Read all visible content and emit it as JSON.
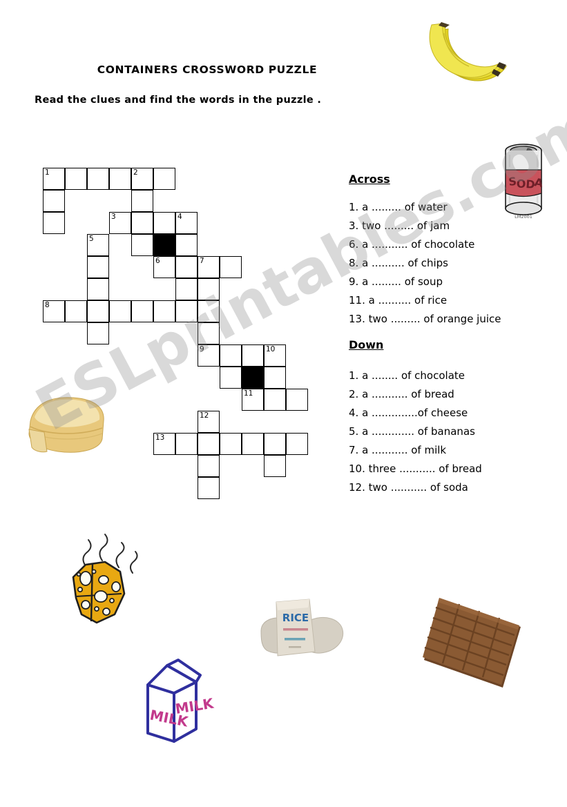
{
  "worksheet": {
    "title": "CONTAINERS CROSSWORD PUZZLE",
    "instruction": "Read the clues and find the words in the puzzle ."
  },
  "watermark": {
    "text": "ESLprintables.com"
  },
  "clues": {
    "across_heading": "Across",
    "down_heading": "Down",
    "across": [
      "1. a ......... of water",
      "3. two ......... of jam",
      "6. a ........... of chocolate",
      "8. a .......... of chips",
      "9. a ......... of soup",
      "11. a .......... of rice",
      "13. two ......... of orange juice"
    ],
    "down": [
      "1. a ........ of chocolate",
      "2. a ........... of bread",
      "4. a  ..............of cheese",
      "5. a ............. of bananas",
      "7. a ........... of milk",
      "10. three ........... of bread",
      "12. two ........... of soda"
    ]
  },
  "grid": {
    "cell_size": 32,
    "cells": [
      {
        "c": 0,
        "r": 0,
        "num": "1"
      },
      {
        "c": 1,
        "r": 0,
        "num": ""
      },
      {
        "c": 2,
        "r": 0,
        "num": ""
      },
      {
        "c": 3,
        "r": 0,
        "num": ""
      },
      {
        "c": 4,
        "r": 0,
        "num": "2"
      },
      {
        "c": 5,
        "r": 0,
        "num": ""
      },
      {
        "c": 0,
        "r": 1,
        "num": ""
      },
      {
        "c": 4,
        "r": 1,
        "num": ""
      },
      {
        "c": 0,
        "r": 2,
        "num": ""
      },
      {
        "c": 3,
        "r": 2,
        "num": "3"
      },
      {
        "c": 4,
        "r": 2,
        "num": ""
      },
      {
        "c": 5,
        "r": 2,
        "num": ""
      },
      {
        "c": 6,
        "r": 2,
        "num": "4"
      },
      {
        "c": 2,
        "r": 3,
        "num": "5"
      },
      {
        "c": 4,
        "r": 3,
        "num": ""
      },
      {
        "c": 5,
        "r": 3,
        "num": "",
        "blocked": true
      },
      {
        "c": 6,
        "r": 3,
        "num": ""
      },
      {
        "c": 2,
        "r": 4,
        "num": ""
      },
      {
        "c": 5,
        "r": 4,
        "num": "6"
      },
      {
        "c": 6,
        "r": 4,
        "num": ""
      },
      {
        "c": 7,
        "r": 4,
        "num": "7"
      },
      {
        "c": 8,
        "r": 4,
        "num": ""
      },
      {
        "c": 2,
        "r": 5,
        "num": ""
      },
      {
        "c": 6,
        "r": 5,
        "num": ""
      },
      {
        "c": 7,
        "r": 5,
        "num": ""
      },
      {
        "c": 0,
        "r": 6,
        "num": "8"
      },
      {
        "c": 1,
        "r": 6,
        "num": ""
      },
      {
        "c": 2,
        "r": 6,
        "num": ""
      },
      {
        "c": 3,
        "r": 6,
        "num": ""
      },
      {
        "c": 4,
        "r": 6,
        "num": ""
      },
      {
        "c": 5,
        "r": 6,
        "num": ""
      },
      {
        "c": 6,
        "r": 6,
        "num": ""
      },
      {
        "c": 7,
        "r": 6,
        "num": ""
      },
      {
        "c": 2,
        "r": 7,
        "num": ""
      },
      {
        "c": 7,
        "r": 7,
        "num": ""
      },
      {
        "c": 7,
        "r": 8,
        "num": "9"
      },
      {
        "c": 8,
        "r": 8,
        "num": ""
      },
      {
        "c": 9,
        "r": 8,
        "num": ""
      },
      {
        "c": 10,
        "r": 8,
        "num": "10"
      },
      {
        "c": 8,
        "r": 9,
        "num": ""
      },
      {
        "c": 9,
        "r": 9,
        "num": "",
        "blocked": true
      },
      {
        "c": 10,
        "r": 9,
        "num": ""
      },
      {
        "c": 9,
        "r": 10,
        "num": "11"
      },
      {
        "c": 10,
        "r": 10,
        "num": ""
      },
      {
        "c": 11,
        "r": 10,
        "num": ""
      },
      {
        "c": 7,
        "r": 11,
        "num": "12"
      },
      {
        "c": 5,
        "r": 12,
        "num": "13"
      },
      {
        "c": 6,
        "r": 12,
        "num": ""
      },
      {
        "c": 7,
        "r": 12,
        "num": ""
      },
      {
        "c": 8,
        "r": 12,
        "num": ""
      },
      {
        "c": 9,
        "r": 12,
        "num": ""
      },
      {
        "c": 10,
        "r": 12,
        "num": ""
      },
      {
        "c": 11,
        "r": 12,
        "num": ""
      },
      {
        "c": 7,
        "r": 13,
        "num": ""
      },
      {
        "c": 10,
        "r": 13,
        "num": ""
      },
      {
        "c": 7,
        "r": 14,
        "num": ""
      }
    ]
  },
  "artwork": {
    "bananas": {
      "name": "bananas-image",
      "color": "#e9de2a",
      "tip_color": "#3a3020"
    },
    "soda": {
      "name": "soda-can-image",
      "label": "SODA",
      "signature": "LM2001",
      "band_color": "#c9535c",
      "metal_color": "#e6e6e6"
    },
    "bread": {
      "name": "bread-loaf-image",
      "crust_color": "#dcb560",
      "crumb_color": "#f2e3b4"
    },
    "cheese": {
      "name": "cheese-image",
      "color": "#e8a812",
      "hole_color": "#ffffff"
    },
    "milk": {
      "name": "milk-carton-image",
      "label": "MILK",
      "outline_color": "#2f2f9e",
      "text_color": "#c23a8c"
    },
    "rice": {
      "name": "rice-sack-image",
      "label": "RICE",
      "sack_color": "#ddd8ce",
      "text_color": "#2b6aa8"
    },
    "chocolate": {
      "name": "chocolate-bar-image",
      "color": "#8a5a33",
      "dark_color": "#6d4425",
      "columns": 4,
      "rows": 6
    }
  }
}
